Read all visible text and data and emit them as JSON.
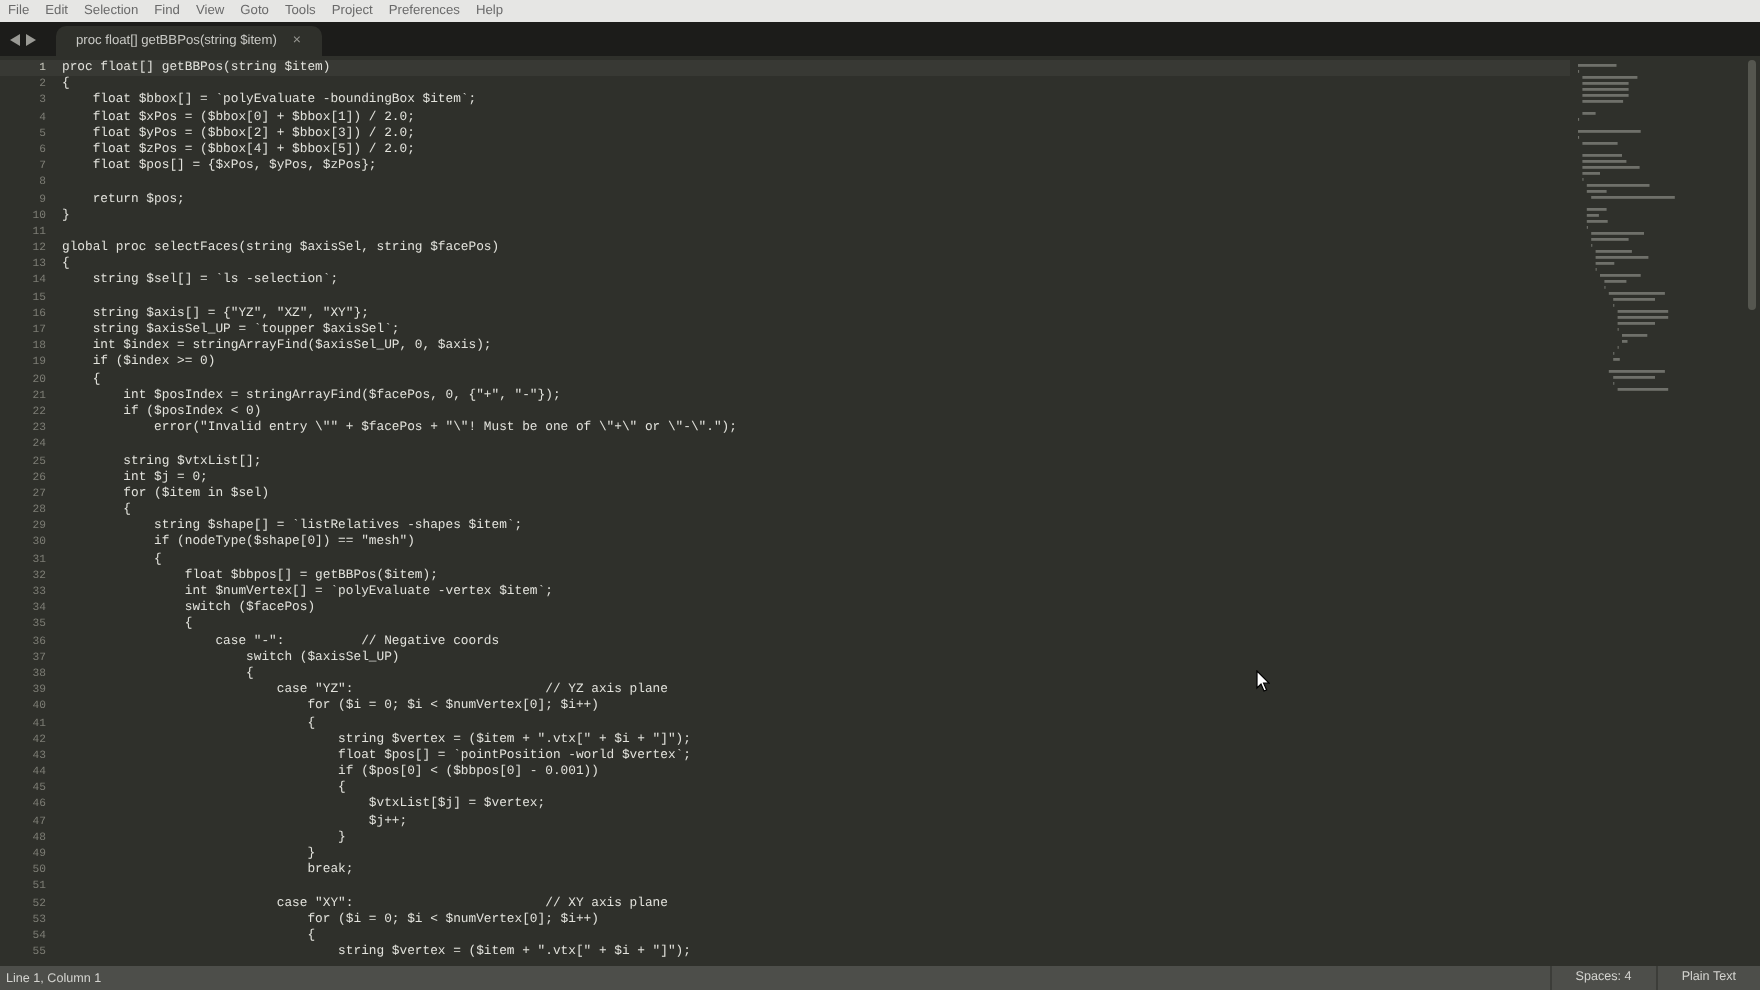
{
  "menu_bar": [
    "File",
    "Edit",
    "Selection",
    "Find",
    "View",
    "Goto",
    "Tools",
    "Project",
    "Preferences",
    "Help"
  ],
  "tabs": [
    {
      "label": "proc float[] getBBPos(string $item)",
      "close": "×",
      "selected": true
    }
  ],
  "editor": {
    "lines": [
      {
        "number": "1",
        "text": "proc float[] getBBPos(string $item)",
        "selected": true
      },
      {
        "number": "2",
        "text": "{",
        "selected": false
      },
      {
        "number": "3",
        "text": "    float $bbox[] = `polyEvaluate -boundingBox $item`;",
        "selected": false
      },
      {
        "number": "4",
        "text": "    float $xPos = ($bbox[0] + $bbox[1]) / 2.0;",
        "selected": false
      },
      {
        "number": "5",
        "text": "    float $yPos = ($bbox[2] + $bbox[3]) / 2.0;",
        "selected": false
      },
      {
        "number": "6",
        "text": "    float $zPos = ($bbox[4] + $bbox[5]) / 2.0;",
        "selected": false
      },
      {
        "number": "7",
        "text": "    float $pos[] = {$xPos, $yPos, $zPos};",
        "selected": false
      },
      {
        "number": "8",
        "selected": false
      },
      {
        "number": "9",
        "text": "    return $pos;",
        "selected": false
      },
      {
        "number": "10",
        "text": "}",
        "selected": false
      },
      {
        "number": "11",
        "selected": false
      },
      {
        "number": "12",
        "text": "global proc selectFaces(string $axisSel, string $facePos)",
        "selected": false
      },
      {
        "number": "13",
        "text": "{",
        "selected": false
      },
      {
        "number": "14",
        "text": "    string $sel[] = `ls -selection`;",
        "selected": false
      },
      {
        "number": "15",
        "selected": false
      },
      {
        "number": "16",
        "text": "    string $axis[] = {\"YZ\", \"XZ\", \"XY\"};",
        "selected": false
      },
      {
        "number": "17",
        "text": "    string $axisSel_UP = `toupper $axisSel`;",
        "selected": false
      },
      {
        "number": "18",
        "text": "    int $index = stringArrayFind($axisSel_UP, 0, $axis);",
        "selected": false
      },
      {
        "number": "19",
        "text": "    if ($index >= 0)",
        "selected": false
      },
      {
        "number": "20",
        "text": "    {",
        "selected": false
      },
      {
        "number": "21",
        "text": "        int $posIndex = stringArrayFind($facePos, 0, {\"+\", \"-\"});",
        "selected": false
      },
      {
        "number": "22",
        "text": "        if ($posIndex < 0)",
        "selected": false
      },
      {
        "number": "23",
        "text": "            error(\"Invalid entry \\\"\" + $facePos + \"\\\"! Must be one of \\\"+\\\" or \\\"-\\\".\");",
        "selected": false
      },
      {
        "number": "24",
        "selected": false
      },
      {
        "number": "25",
        "text": "        string $vtxList[];",
        "selected": false
      },
      {
        "number": "26",
        "text": "        int $j = 0;",
        "selected": false
      },
      {
        "number": "27",
        "text": "        for ($item in $sel)",
        "selected": false
      },
      {
        "number": "28",
        "text": "        {",
        "selected": false
      },
      {
        "number": "29",
        "text": "            string $shape[] = `listRelatives -shapes $item`;",
        "selected": false
      },
      {
        "number": "30",
        "text": "            if (nodeType($shape[0]) == \"mesh\")",
        "selected": false
      },
      {
        "number": "31",
        "text": "            {",
        "selected": false
      },
      {
        "number": "32",
        "text": "                float $bbpos[] = getBBPos($item);",
        "selected": false
      },
      {
        "number": "33",
        "text": "                int $numVertex[] = `polyEvaluate -vertex $item`;",
        "selected": false
      },
      {
        "number": "34",
        "text": "                switch ($facePos)",
        "selected": false
      },
      {
        "number": "35",
        "text": "                {",
        "selected": false
      },
      {
        "number": "36",
        "text": "                    case \"-\":          // Negative coords",
        "selected": false
      },
      {
        "number": "37",
        "text": "                        switch ($axisSel_UP)",
        "selected": false
      },
      {
        "number": "38",
        "text": "                        {",
        "selected": false
      },
      {
        "number": "39",
        "text": "                            case \"YZ\":                         // YZ axis plane",
        "selected": false
      },
      {
        "number": "40",
        "text": "                                for ($i = 0; $i < $numVertex[0]; $i++)",
        "selected": false
      },
      {
        "number": "41",
        "text": "                                {",
        "selected": false
      },
      {
        "number": "42",
        "text": "                                    string $vertex = ($item + \".vtx[\" + $i + \"]\");",
        "selected": false
      },
      {
        "number": "43",
        "text": "                                    float $pos[] = `pointPosition -world $vertex`;",
        "selected": false
      },
      {
        "number": "44",
        "text": "                                    if ($pos[0] < ($bbpos[0] - 0.001))",
        "selected": false
      },
      {
        "number": "45",
        "text": "                                    {",
        "selected": false
      },
      {
        "number": "46",
        "text": "                                        $vtxList[$j] = $vertex;",
        "selected": false
      },
      {
        "number": "47",
        "text": "                                        $j++;",
        "selected": false
      },
      {
        "number": "48",
        "text": "                                    }",
        "selected": false
      },
      {
        "number": "49",
        "text": "                                }",
        "selected": false
      },
      {
        "number": "50",
        "text": "                                break;",
        "selected": false
      },
      {
        "number": "51",
        "selected": false
      },
      {
        "number": "52",
        "text": "                            case \"XY\":                         // XY axis plane",
        "selected": false
      },
      {
        "number": "53",
        "text": "                                for ($i = 0; $i < $numVertex[0]; $i++)",
        "selected": false
      },
      {
        "number": "54",
        "text": "                                {",
        "selected": false
      },
      {
        "number": "55",
        "text": "                                    string $vertex = ($item + \".vtx[\" + $i + \"]\");",
        "selected": false
      }
    ]
  },
  "status_bar": {
    "position": "Line 1, Column 1",
    "indentation": "Spaces: 4",
    "syntax": "Plain Text"
  }
}
